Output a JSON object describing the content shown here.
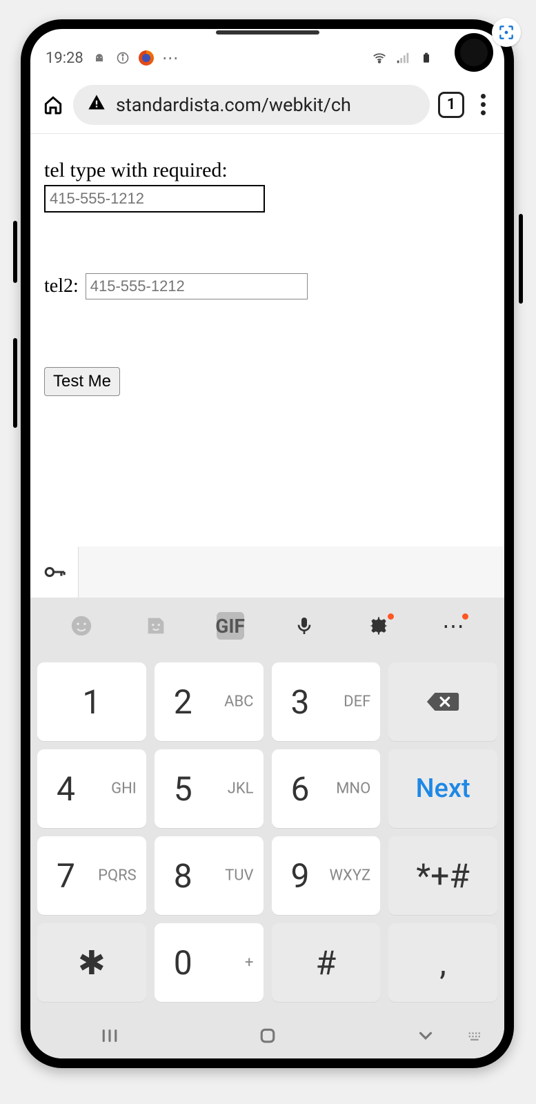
{
  "status": {
    "time": "19:28",
    "icons": {
      "android": "android-icon",
      "info": "info-icon",
      "firefox": "firefox-icon",
      "more": "⋯"
    }
  },
  "browser": {
    "url": "standardista.com/webkit/ch",
    "tab_count": "1"
  },
  "page": {
    "label1": "tel type with required:",
    "placeholder1": "415-555-1212",
    "label2": "tel2:",
    "placeholder2": "415-555-1212",
    "button": "Test Me"
  },
  "keyboard": {
    "toolbar": {
      "gif": "GIF"
    },
    "next_label": "Next",
    "keys": [
      {
        "n": "1",
        "s": ""
      },
      {
        "n": "2",
        "s": "ABC"
      },
      {
        "n": "3",
        "s": "DEF"
      },
      {
        "n": "⌫",
        "s": "",
        "type": "backspace"
      },
      {
        "n": "4",
        "s": "GHI"
      },
      {
        "n": "5",
        "s": "JKL"
      },
      {
        "n": "6",
        "s": "MNO"
      },
      {
        "n": "Next",
        "s": "",
        "type": "next"
      },
      {
        "n": "7",
        "s": "PQRS"
      },
      {
        "n": "8",
        "s": "TUV"
      },
      {
        "n": "9",
        "s": "WXYZ"
      },
      {
        "n": "*+#",
        "s": "",
        "type": "grey"
      },
      {
        "n": "✱",
        "s": "",
        "type": "grey",
        "alt": "*"
      },
      {
        "n": "0",
        "s": "+"
      },
      {
        "n": "#",
        "s": "",
        "type": "grey"
      },
      {
        "n": ",",
        "s": "",
        "type": "grey"
      }
    ]
  }
}
